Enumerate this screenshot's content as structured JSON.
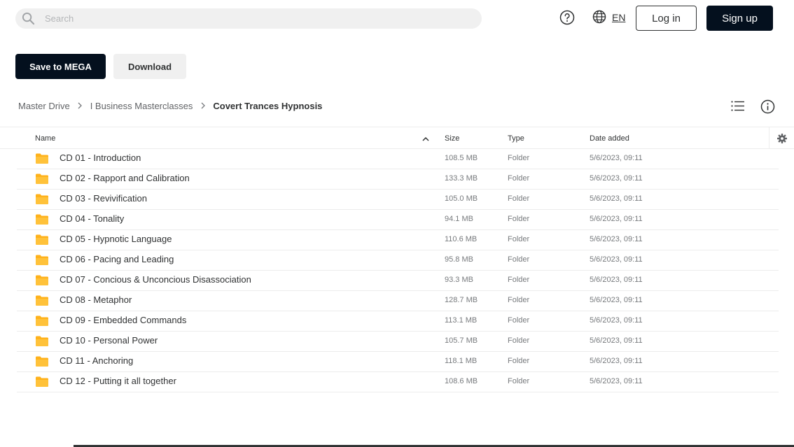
{
  "header": {
    "search_placeholder": "Search",
    "language": "EN",
    "login_label": "Log in",
    "signup_label": "Sign up"
  },
  "actions": {
    "save_label": "Save to MEGA",
    "download_label": "Download"
  },
  "breadcrumb": [
    "Master Drive",
    "I Business Masterclasses",
    "Covert Trances Hypnosis"
  ],
  "table": {
    "columns": {
      "name": "Name",
      "size": "Size",
      "type": "Type",
      "date": "Date added"
    },
    "rows": [
      {
        "name": "CD 01 - Introduction",
        "size": "108.5 MB",
        "type": "Folder",
        "date": "5/6/2023, 09:11"
      },
      {
        "name": "CD 02 - Rapport and Calibration",
        "size": "133.3 MB",
        "type": "Folder",
        "date": "5/6/2023, 09:11"
      },
      {
        "name": "CD 03 - Revivification",
        "size": "105.0 MB",
        "type": "Folder",
        "date": "5/6/2023, 09:11"
      },
      {
        "name": "CD 04 - Tonality",
        "size": "94.1 MB",
        "type": "Folder",
        "date": "5/6/2023, 09:11"
      },
      {
        "name": "CD 05 - Hypnotic Language",
        "size": "110.6 MB",
        "type": "Folder",
        "date": "5/6/2023, 09:11"
      },
      {
        "name": "CD 06 - Pacing and Leading",
        "size": "95.8 MB",
        "type": "Folder",
        "date": "5/6/2023, 09:11"
      },
      {
        "name": "CD 07 - Concious & Unconcious Disassociation",
        "size": "93.3 MB",
        "type": "Folder",
        "date": "5/6/2023, 09:11"
      },
      {
        "name": "CD 08 - Metaphor",
        "size": "128.7 MB",
        "type": "Folder",
        "date": "5/6/2023, 09:11"
      },
      {
        "name": "CD 09 - Embedded Commands",
        "size": "113.1 MB",
        "type": "Folder",
        "date": "5/6/2023, 09:11"
      },
      {
        "name": "CD 10 - Personal Power",
        "size": "105.7 MB",
        "type": "Folder",
        "date": "5/6/2023, 09:11"
      },
      {
        "name": "CD 11 - Anchoring",
        "size": "118.1 MB",
        "type": "Folder",
        "date": "5/6/2023, 09:11"
      },
      {
        "name": "CD 12 - Putting it all together",
        "size": "108.6 MB",
        "type": "Folder",
        "date": "5/6/2023, 09:11"
      }
    ]
  },
  "icons": {
    "search": "search-icon",
    "help": "help-circle-icon",
    "globe": "globe-icon",
    "list_view": "list-view-icon",
    "info": "info-icon",
    "sort": "chevron-up-icon",
    "settings": "gear-icon",
    "folder": "folder-icon"
  },
  "colors": {
    "primary_dark": "#04101e",
    "folder": "#ffb21b",
    "muted_text": "#777a7d",
    "surface": "#f0f0f0"
  }
}
